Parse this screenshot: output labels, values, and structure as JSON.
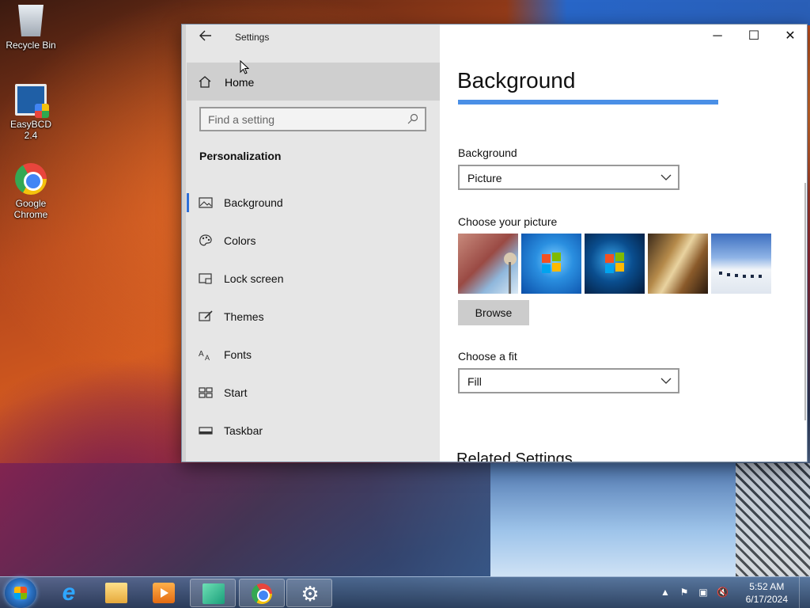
{
  "desktop": {
    "icons": [
      {
        "label": "Recycle Bin",
        "icon": "recycle-bin-icon"
      },
      {
        "label": "EasyBCD 2.4",
        "icon": "easybcd-icon"
      },
      {
        "label": "Google Chrome",
        "icon": "chrome-icon"
      }
    ]
  },
  "window": {
    "title": "Settings",
    "controls": {
      "minimize": "─",
      "maximize": "☐",
      "close": "✕"
    },
    "nav": {
      "home_label": "Home",
      "search_placeholder": "Find a setting",
      "section_heading": "Personalization",
      "items": [
        {
          "label": "Background",
          "icon": "picture-icon",
          "active": true
        },
        {
          "label": "Colors",
          "icon": "palette-icon",
          "active": false
        },
        {
          "label": "Lock screen",
          "icon": "lock-screen-icon",
          "active": false
        },
        {
          "label": "Themes",
          "icon": "brush-icon",
          "active": false
        },
        {
          "label": "Fonts",
          "icon": "fonts-icon",
          "active": false
        },
        {
          "label": "Start",
          "icon": "start-grid-icon",
          "active": false
        },
        {
          "label": "Taskbar",
          "icon": "taskbar-icon",
          "active": false
        }
      ]
    },
    "content": {
      "page_title": "Background",
      "background_label": "Background",
      "background_value": "Picture",
      "choose_picture_label": "Choose your picture",
      "browse_label": "Browse",
      "choose_fit_label": "Choose a fit",
      "fit_value": "Fill",
      "related_heading": "Related Settings",
      "accent_color": "#4a8fe6"
    }
  },
  "taskbar": {
    "apps": [
      "internet-explorer-icon",
      "file-explorer-icon",
      "media-player-icon",
      "phone-companion-icon",
      "chrome-icon",
      "settings-gear-icon"
    ],
    "clock_time": "5:52 AM",
    "clock_date": "6/17/2024"
  }
}
